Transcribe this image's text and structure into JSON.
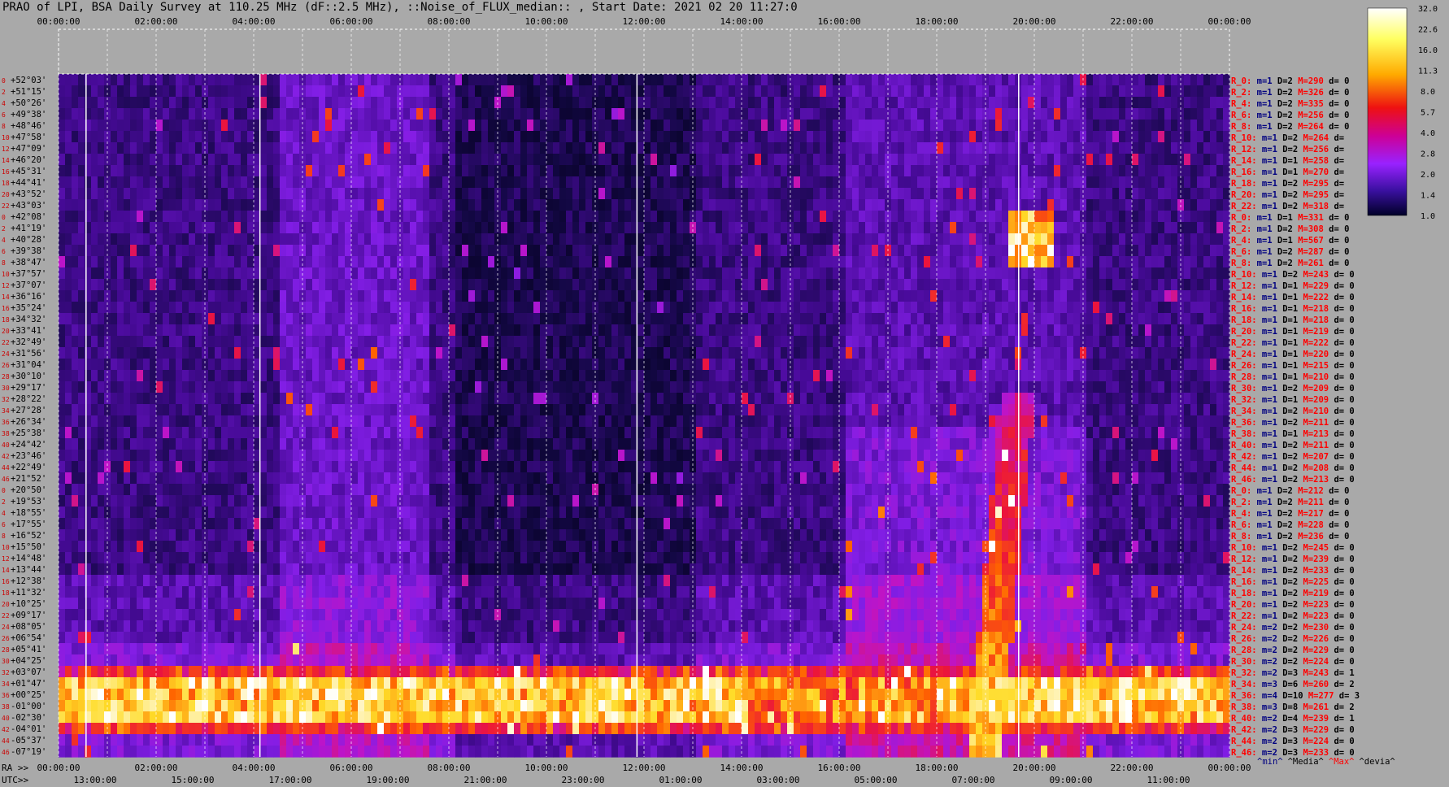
{
  "title": "PRAO of LPI, BSA Daily Survey at 110.25 MHz (dF::2.5 MHz), ::Noise_of_FLUX_median:: , Start Date: 2021 02 20 11:27:0",
  "chart_data": {
    "type": "heatmap",
    "title": "PRAO of LPI, BSA Daily Survey at 110.25 MHz (dF::2.5 MHz), ::Noise_of_FLUX_median:: , Start Date: 2021 02 20 11:27:0",
    "top_axis_ticks": [
      "00:00:00",
      "02:00:00",
      "04:00:00",
      "06:00:00",
      "08:00:00",
      "10:00:00",
      "12:00:00",
      "14:00:00",
      "16:00:00",
      "18:00:00",
      "20:00:00",
      "22:00:00",
      "00:00:00"
    ],
    "ra_axis_prefix": "RA >>",
    "ra_axis_ticks": [
      "00:00:00",
      "02:00:00",
      "04:00:00",
      "06:00:00",
      "08:00:00",
      "10:00:00",
      "12:00:00",
      "14:00:00",
      "16:00:00",
      "18:00:00",
      "20:00:00",
      "22:00:00",
      "00:00:00"
    ],
    "utc_axis_prefix": "UTC>>",
    "utc_axis_ticks": [
      "13:00:00",
      "15:00:00",
      "17:00:00",
      "19:00:00",
      "21:00:00",
      "23:00:00",
      "01:00:00",
      "03:00:00",
      "05:00:00",
      "07:00:00",
      "09:00:00",
      "11:00:00"
    ],
    "dec_labels": [
      "+52°03'",
      "+51°15'",
      "+50°26'",
      "+49°38'",
      "+48°46'",
      "+47°58'",
      "+47°09'",
      "+46°20'",
      "+45°31'",
      "+44°41'",
      "+43°52'",
      "+43°03'",
      "+42°08'",
      "+41°19'",
      "+40°28'",
      "+39°38'",
      "+38°47'",
      "+37°57'",
      "+37°07'",
      "+36°16'",
      "+35°24'",
      "+34°32'",
      "+33°41'",
      "+32°49'",
      "+31°56'",
      "+31°04'",
      "+30°10'",
      "+29°17'",
      "+28°22'",
      "+27°28'",
      "+26°34'",
      "+25°38'",
      "+24°42'",
      "+23°46'",
      "+22°49'",
      "+21°52'",
      "+20°50'",
      "+19°53'",
      "+18°55'",
      "+17°55'",
      "+16°52'",
      "+15°50'",
      "+14°48'",
      "+13°44'",
      "+12°38'",
      "+11°32'",
      "+10°25'",
      "+09°17'",
      "+08°05'",
      "+06°54'",
      "+05°41'",
      "+04°25'",
      "+03°07'",
      "+01°47'",
      "+00°25'",
      "-01°00'",
      "-02°30'",
      "-04°01'",
      "-05°37'",
      "-07°19'"
    ],
    "beam_numbers": [
      0,
      2,
      4,
      6,
      8,
      10,
      12,
      14,
      16,
      18,
      20,
      22,
      0,
      2,
      4,
      6,
      8,
      10,
      12,
      14,
      16,
      18,
      20,
      22,
      24,
      26,
      28,
      30,
      32,
      34,
      36,
      38,
      40,
      42,
      44,
      46,
      0,
      2,
      4,
      6,
      8,
      10,
      12,
      14,
      16,
      18,
      20,
      22,
      24,
      26,
      28,
      30,
      32,
      34,
      36,
      38,
      40,
      42,
      44,
      46
    ],
    "row_stats": [
      {
        "r": "R_0:",
        "m": "m=1",
        "D": "D=2",
        "M": "M=290",
        "d": "d= 0"
      },
      {
        "r": "R_2:",
        "m": "m=1",
        "D": "D=2",
        "M": "M=326",
        "d": "d= 0"
      },
      {
        "r": "R_4:",
        "m": "m=1",
        "D": "D=2",
        "M": "M=335",
        "d": "d= 0"
      },
      {
        "r": "R_6:",
        "m": "m=1",
        "D": "D=2",
        "M": "M=256",
        "d": "d= 0"
      },
      {
        "r": "R_8:",
        "m": "m=1",
        "D": "D=2",
        "M": "M=264",
        "d": "d= 0"
      },
      {
        "r": "R_10:",
        "m": "m=1",
        "D": "D=2",
        "M": "M=264",
        "d": "d="
      },
      {
        "r": "R_12:",
        "m": "m=1",
        "D": "D=2",
        "M": "M=256",
        "d": "d="
      },
      {
        "r": "R_14:",
        "m": "m=1",
        "D": "D=1",
        "M": "M=258",
        "d": "d="
      },
      {
        "r": "R_16:",
        "m": "m=1",
        "D": "D=1",
        "M": "M=270",
        "d": "d="
      },
      {
        "r": "R_18:",
        "m": "m=1",
        "D": "D=2",
        "M": "M=295",
        "d": "d="
      },
      {
        "r": "R_20:",
        "m": "m=1",
        "D": "D=2",
        "M": "M=295",
        "d": "d="
      },
      {
        "r": "R_22:",
        "m": "m=1",
        "D": "D=2",
        "M": "M=318",
        "d": "d="
      },
      {
        "r": "R_0:",
        "m": "m=1",
        "D": "D=1",
        "M": "M=331",
        "d": "d= 0"
      },
      {
        "r": "R_2:",
        "m": "m=1",
        "D": "D=2",
        "M": "M=308",
        "d": "d= 0"
      },
      {
        "r": "R_4:",
        "m": "m=1",
        "D": "D=1",
        "M": "M=567",
        "d": "d= 0"
      },
      {
        "r": "R_6:",
        "m": "m=1",
        "D": "D=2",
        "M": "M=287",
        "d": "d= 0"
      },
      {
        "r": "R_8:",
        "m": "m=1",
        "D": "D=2",
        "M": "M=261",
        "d": "d= 0"
      },
      {
        "r": "R_10:",
        "m": "m=1",
        "D": "D=2",
        "M": "M=243",
        "d": "d= 0"
      },
      {
        "r": "R_12:",
        "m": "m=1",
        "D": "D=1",
        "M": "M=229",
        "d": "d= 0"
      },
      {
        "r": "R_14:",
        "m": "m=1",
        "D": "D=1",
        "M": "M=222",
        "d": "d= 0"
      },
      {
        "r": "R_16:",
        "m": "m=1",
        "D": "D=1",
        "M": "M=218",
        "d": "d= 0"
      },
      {
        "r": "R_18:",
        "m": "m=1",
        "D": "D=1",
        "M": "M=218",
        "d": "d= 0"
      },
      {
        "r": "R_20:",
        "m": "m=1",
        "D": "D=1",
        "M": "M=219",
        "d": "d= 0"
      },
      {
        "r": "R_22:",
        "m": "m=1",
        "D": "D=1",
        "M": "M=222",
        "d": "d= 0"
      },
      {
        "r": "R_24:",
        "m": "m=1",
        "D": "D=1",
        "M": "M=220",
        "d": "d= 0"
      },
      {
        "r": "R_26:",
        "m": "m=1",
        "D": "D=1",
        "M": "M=215",
        "d": "d= 0"
      },
      {
        "r": "R_28:",
        "m": "m=1",
        "D": "D=1",
        "M": "M=210",
        "d": "d= 0"
      },
      {
        "r": "R_30:",
        "m": "m=1",
        "D": "D=2",
        "M": "M=209",
        "d": "d= 0"
      },
      {
        "r": "R_32:",
        "m": "m=1",
        "D": "D=1",
        "M": "M=209",
        "d": "d= 0"
      },
      {
        "r": "R_34:",
        "m": "m=1",
        "D": "D=2",
        "M": "M=210",
        "d": "d= 0"
      },
      {
        "r": "R_36:",
        "m": "m=1",
        "D": "D=2",
        "M": "M=211",
        "d": "d= 0"
      },
      {
        "r": "R_38:",
        "m": "m=1",
        "D": "D=1",
        "M": "M=213",
        "d": "d= 0"
      },
      {
        "r": "R_40:",
        "m": "m=1",
        "D": "D=2",
        "M": "M=211",
        "d": "d= 0"
      },
      {
        "r": "R_42:",
        "m": "m=1",
        "D": "D=2",
        "M": "M=207",
        "d": "d= 0"
      },
      {
        "r": "R_44:",
        "m": "m=1",
        "D": "D=2",
        "M": "M=208",
        "d": "d= 0"
      },
      {
        "r": "R_46:",
        "m": "m=1",
        "D": "D=2",
        "M": "M=213",
        "d": "d= 0"
      },
      {
        "r": "R_0:",
        "m": "m=1",
        "D": "D=2",
        "M": "M=212",
        "d": "d= 0"
      },
      {
        "r": "R_2:",
        "m": "m=1",
        "D": "D=2",
        "M": "M=211",
        "d": "d= 0"
      },
      {
        "r": "R_4:",
        "m": "m=1",
        "D": "D=2",
        "M": "M=217",
        "d": "d= 0"
      },
      {
        "r": "R_6:",
        "m": "m=1",
        "D": "D=2",
        "M": "M=228",
        "d": "d= 0"
      },
      {
        "r": "R_8:",
        "m": "m=1",
        "D": "D=2",
        "M": "M=236",
        "d": "d= 0"
      },
      {
        "r": "R_10:",
        "m": "m=1",
        "D": "D=2",
        "M": "M=245",
        "d": "d= 0"
      },
      {
        "r": "R_12:",
        "m": "m=1",
        "D": "D=2",
        "M": "M=239",
        "d": "d= 0"
      },
      {
        "r": "R_14:",
        "m": "m=1",
        "D": "D=2",
        "M": "M=233",
        "d": "d= 0"
      },
      {
        "r": "R_16:",
        "m": "m=1",
        "D": "D=2",
        "M": "M=225",
        "d": "d= 0"
      },
      {
        "r": "R_18:",
        "m": "m=1",
        "D": "D=2",
        "M": "M=219",
        "d": "d= 0"
      },
      {
        "r": "R_20:",
        "m": "m=1",
        "D": "D=2",
        "M": "M=223",
        "d": "d= 0"
      },
      {
        "r": "R_22:",
        "m": "m=1",
        "D": "D=2",
        "M": "M=223",
        "d": "d= 0"
      },
      {
        "r": "R_24:",
        "m": "m=2",
        "D": "D=2",
        "M": "M=230",
        "d": "d= 0"
      },
      {
        "r": "R_26:",
        "m": "m=2",
        "D": "D=2",
        "M": "M=226",
        "d": "d= 0"
      },
      {
        "r": "R_28:",
        "m": "m=2",
        "D": "D=2",
        "M": "M=229",
        "d": "d= 0"
      },
      {
        "r": "R_30:",
        "m": "m=2",
        "D": "D=2",
        "M": "M=224",
        "d": "d= 0"
      },
      {
        "r": "R_32:",
        "m": "m=2",
        "D": "D=3",
        "M": "M=243",
        "d": "d= 1"
      },
      {
        "r": "R_34:",
        "m": "m=3",
        "D": "D=6",
        "M": "M=260",
        "d": "d= 2"
      },
      {
        "r": "R_36:",
        "m": "m=4",
        "D": "D=10",
        "M": "M=277",
        "d": "d= 3"
      },
      {
        "r": "R_38:",
        "m": "m=3",
        "D": "D=8",
        "M": "M=261",
        "d": "d= 2"
      },
      {
        "r": "R_40:",
        "m": "m=2",
        "D": "D=4",
        "M": "M=239",
        "d": "d= 1"
      },
      {
        "r": "R_42:",
        "m": "m=2",
        "D": "D=3",
        "M": "M=229",
        "d": "d= 0"
      },
      {
        "r": "R_44:",
        "m": "m=2",
        "D": "D=3",
        "M": "M=224",
        "d": "d= 0"
      },
      {
        "r": "R_46:",
        "m": "m=2",
        "D": "D=3",
        "M": "M=233",
        "d": "d= 0"
      }
    ],
    "stats_legend": [
      "^min^",
      "^Media^",
      "^Max^",
      "^devia^"
    ],
    "colorbar_ticks": [
      "32.0",
      "22.6",
      "16.0",
      "11.3",
      "8.0",
      "5.7",
      "4.0",
      "2.8",
      "2.0",
      "1.4",
      "1.0"
    ],
    "colorbar_scale": "log",
    "colors": {
      "text": "#000000",
      "beam_label": "#cc0000",
      "stat_label_red": "#ff0000",
      "stat_value_blue": "#000080",
      "background": "#a9a9a9"
    },
    "features": {
      "bright_band_dec": "+00°25'",
      "bright_source_ra": "20:00:00",
      "bright_source_dec": "+41°19'"
    }
  }
}
